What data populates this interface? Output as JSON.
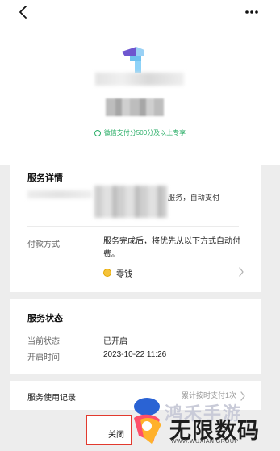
{
  "header": {
    "back_icon": "chevron-left-icon",
    "more_icon": "ellipsis-icon"
  },
  "brand": {
    "logo_icon": "service-logo-icon",
    "promo_text": "微信支付分500分及以上专享",
    "promo_icon": "check-circle-icon",
    "accent_color": "#2aae67"
  },
  "service_detail": {
    "title": "服务详情",
    "description_visible": "服务，自动支付",
    "payment_label": "付款方式",
    "payment_description": "服务完成后，将优先从以下方式自动付费。",
    "payment_method": "零钱",
    "payment_icon": "coin-icon"
  },
  "service_status": {
    "title": "服务状态",
    "rows": [
      {
        "label": "当前状态",
        "value": "已开启"
      },
      {
        "label": "开启时间",
        "value": "2023-10-22 11:26"
      }
    ]
  },
  "usage": {
    "label": "服务使用记录",
    "value": "累计按时支付1次"
  },
  "actions": {
    "close_label": "关闭"
  },
  "watermark": {
    "faint_text": "鸿禾手游",
    "main_text": "无限数码",
    "sub_text": "WWW.WUXIAN GROUP",
    "highlight_color": "#e23a2e"
  }
}
